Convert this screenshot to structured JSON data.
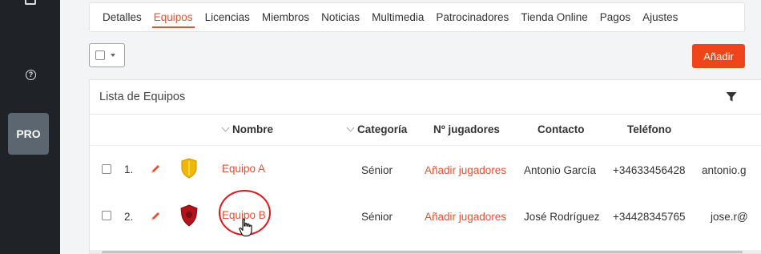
{
  "sidebar": {
    "icons": [
      "dashboard-icon",
      "help-icon"
    ],
    "pro_label": "PRO"
  },
  "tabs": [
    {
      "label": "Detalles",
      "active": false
    },
    {
      "label": "Equipos",
      "active": true
    },
    {
      "label": "Licencias",
      "active": false
    },
    {
      "label": "Miembros",
      "active": false
    },
    {
      "label": "Noticias",
      "active": false
    },
    {
      "label": "Multimedia",
      "active": false
    },
    {
      "label": "Patrocinadores",
      "active": false
    },
    {
      "label": "Tienda Online",
      "active": false
    },
    {
      "label": "Pagos",
      "active": false
    },
    {
      "label": "Ajustes",
      "active": false
    }
  ],
  "toolbar": {
    "add_label": "Añadir"
  },
  "panel": {
    "title": "Lista de Equipos",
    "columns": {
      "nombre": "Nombre",
      "categoria": "Categoría",
      "jugadores": "Nº jugadores",
      "contacto": "Contacto",
      "telefono": "Teléfono"
    },
    "rows": [
      {
        "index": "1.",
        "name": "Equipo A",
        "category": "Sénior",
        "players_link": "Añadir jugadores",
        "contact": "Antonio García",
        "phone": "+34633456428",
        "email": "antonio.g",
        "shield_color": "#f2b705"
      },
      {
        "index": "2.",
        "name": "Equipo B",
        "category": "Sénior",
        "players_link": "Añadir jugadores",
        "contact": "José Rodríguez",
        "phone": "+34428345765",
        "email": "jose.r@",
        "shield_color": "#b3141c"
      }
    ]
  },
  "colors": {
    "accent": "#e8502f",
    "button": "#f0441b",
    "sidebar": "#1f2226",
    "pro_badge": "#5b6670",
    "highlight": "#e0161d"
  }
}
